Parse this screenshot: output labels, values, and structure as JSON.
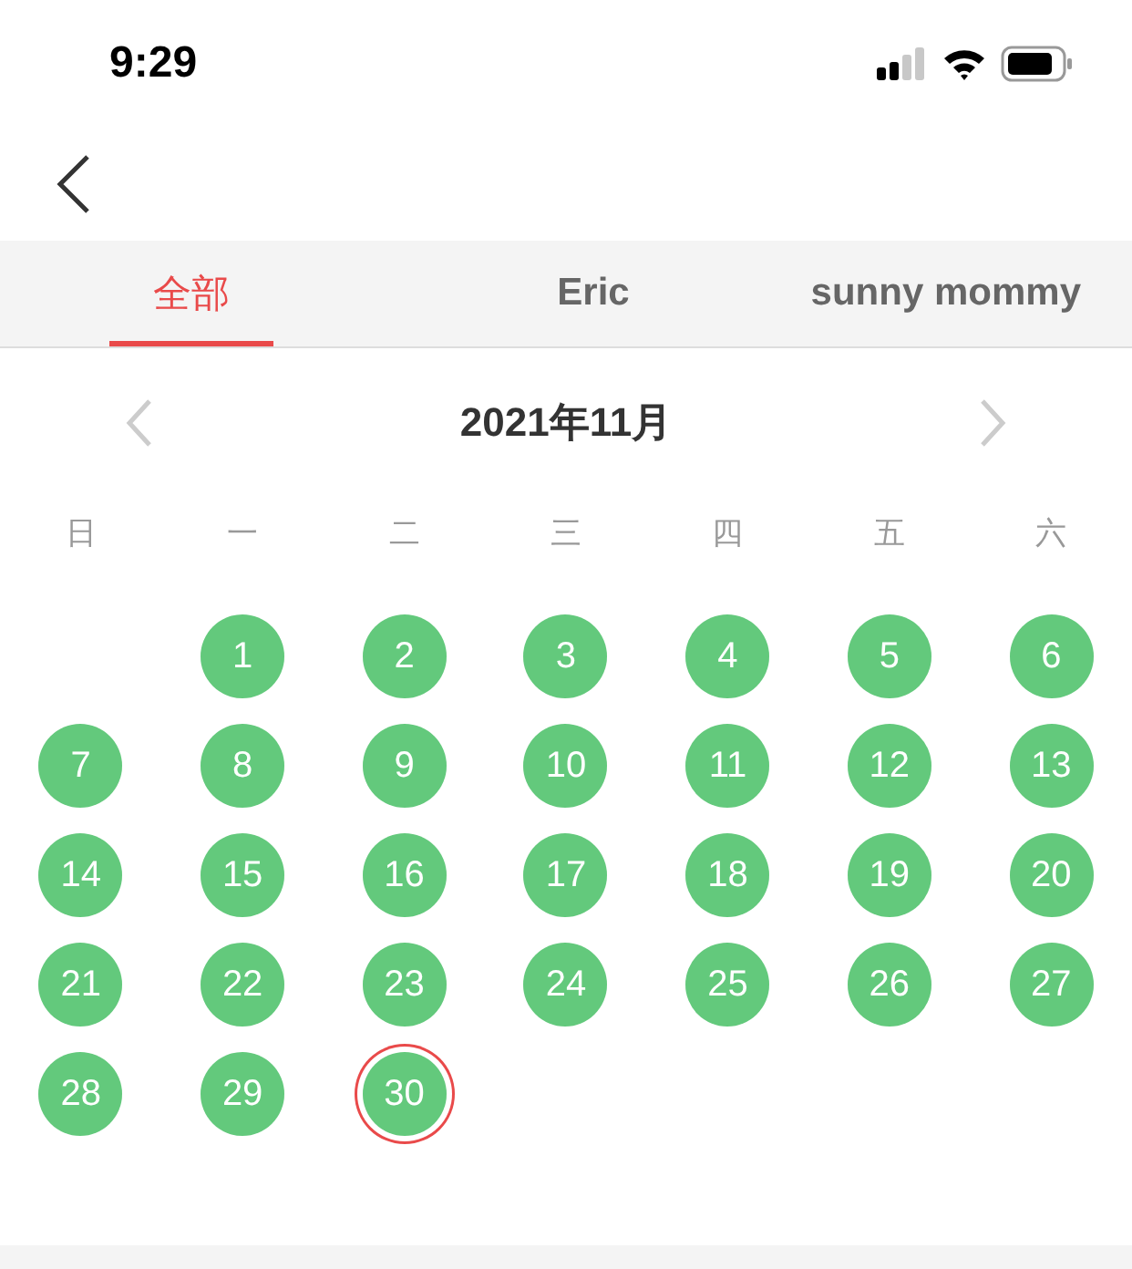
{
  "status_bar": {
    "time": "9:29"
  },
  "tabs": [
    {
      "label": "全部",
      "selected": true
    },
    {
      "label": "Eric",
      "selected": false
    },
    {
      "label": "sunny mommy",
      "selected": false
    }
  ],
  "calendar": {
    "month": "2021年11月",
    "weekdays": [
      "日",
      "一",
      "二",
      "三",
      "四",
      "五",
      "六"
    ],
    "cells": [
      {
        "kind": "empty"
      },
      {
        "kind": "day",
        "label": "1",
        "marked": true,
        "today": false
      },
      {
        "kind": "day",
        "label": "2",
        "marked": true,
        "today": false
      },
      {
        "kind": "day",
        "label": "3",
        "marked": true,
        "today": false
      },
      {
        "kind": "day",
        "label": "4",
        "marked": true,
        "today": false
      },
      {
        "kind": "day",
        "label": "5",
        "marked": true,
        "today": false
      },
      {
        "kind": "day",
        "label": "6",
        "marked": true,
        "today": false
      },
      {
        "kind": "day",
        "label": "7",
        "marked": true,
        "today": false
      },
      {
        "kind": "day",
        "label": "8",
        "marked": true,
        "today": false
      },
      {
        "kind": "day",
        "label": "9",
        "marked": true,
        "today": false
      },
      {
        "kind": "day",
        "label": "10",
        "marked": true,
        "today": false
      },
      {
        "kind": "day",
        "label": "11",
        "marked": true,
        "today": false
      },
      {
        "kind": "day",
        "label": "12",
        "marked": true,
        "today": false
      },
      {
        "kind": "day",
        "label": "13",
        "marked": true,
        "today": false
      },
      {
        "kind": "day",
        "label": "14",
        "marked": true,
        "today": false
      },
      {
        "kind": "day",
        "label": "15",
        "marked": true,
        "today": false
      },
      {
        "kind": "day",
        "label": "16",
        "marked": true,
        "today": false
      },
      {
        "kind": "day",
        "label": "17",
        "marked": true,
        "today": false
      },
      {
        "kind": "day",
        "label": "18",
        "marked": true,
        "today": false
      },
      {
        "kind": "day",
        "label": "19",
        "marked": true,
        "today": false
      },
      {
        "kind": "day",
        "label": "20",
        "marked": true,
        "today": false
      },
      {
        "kind": "day",
        "label": "21",
        "marked": true,
        "today": false
      },
      {
        "kind": "day",
        "label": "22",
        "marked": true,
        "today": false
      },
      {
        "kind": "day",
        "label": "23",
        "marked": true,
        "today": false
      },
      {
        "kind": "day",
        "label": "24",
        "marked": true,
        "today": false
      },
      {
        "kind": "day",
        "label": "25",
        "marked": true,
        "today": false
      },
      {
        "kind": "day",
        "label": "26",
        "marked": true,
        "today": false
      },
      {
        "kind": "day",
        "label": "27",
        "marked": true,
        "today": false
      },
      {
        "kind": "day",
        "label": "28",
        "marked": true,
        "today": false
      },
      {
        "kind": "day",
        "label": "29",
        "marked": true,
        "today": false
      },
      {
        "kind": "day",
        "label": "30",
        "marked": true,
        "today": true
      }
    ]
  }
}
